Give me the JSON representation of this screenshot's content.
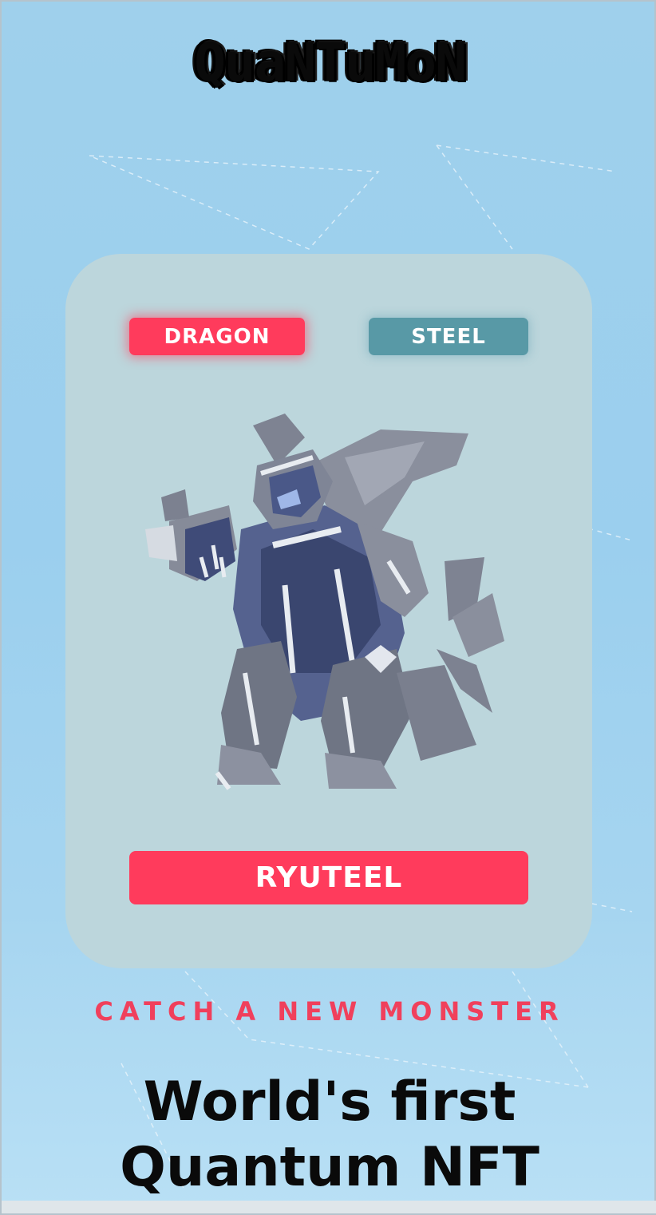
{
  "header": {
    "logo_text": "QuaNTuMoN"
  },
  "card": {
    "types": [
      {
        "label": "DRAGON",
        "color": "#ff3b5c"
      },
      {
        "label": "STEEL",
        "color": "#5899a6"
      }
    ],
    "monster_image": "steel-dragon-monster",
    "monster_name": "RYUTEEL"
  },
  "cta": {
    "catch_label": "CATCH A NEW MONSTER"
  },
  "hero": {
    "line1": "World's first",
    "line2": "Quantum NFT"
  },
  "colors": {
    "accent": "#ff3b5c",
    "steel": "#5899a6",
    "card_bg": "#bcd6dc",
    "page_bg": "#9fd0ec"
  }
}
